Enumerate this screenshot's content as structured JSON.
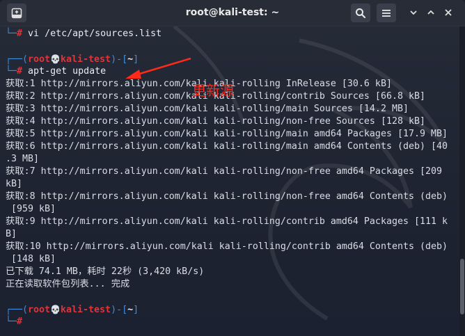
{
  "window": {
    "title": "root@kali-test: ~",
    "new_tab_icon": "terminal-plus-icon",
    "search_icon": "search-icon",
    "menu_icon": "hamburger-menu-icon",
    "minimize_icon": "minimize-icon",
    "maximize_icon": "maximize-icon",
    "close_icon": "close-icon"
  },
  "terminal": {
    "prev_command": "vi /etc/apt/sources.list",
    "prompt": {
      "open": "┌──(",
      "user": "root",
      "skull": "💀",
      "host": "kali-test",
      "mid": ")-[",
      "dir": "~",
      "close": "]",
      "corner": "└─",
      "symbol": "#"
    },
    "command": "apt-get update",
    "output": [
      "获取:1 http://mirrors.aliyun.com/kali kali-rolling InRelease [30.6 kB]",
      "获取:2 http://mirrors.aliyun.com/kali kali-rolling/contrib Sources [66.8 kB]",
      "获取:3 http://mirrors.aliyun.com/kali kali-rolling/main Sources [14.2 MB]",
      "获取:4 http://mirrors.aliyun.com/kali kali-rolling/non-free Sources [128 kB]",
      "获取:5 http://mirrors.aliyun.com/kali kali-rolling/main amd64 Packages [17.9 MB]",
      "获取:6 http://mirrors.aliyun.com/kali kali-rolling/main amd64 Contents (deb) [40",
      ".3 MB]",
      "获取:7 http://mirrors.aliyun.com/kali kali-rolling/non-free amd64 Packages [209",
      "kB]",
      "获取:8 http://mirrors.aliyun.com/kali kali-rolling/non-free amd64 Contents (deb)",
      " [959 kB]",
      "获取:9 http://mirrors.aliyun.com/kali kali-rolling/contrib amd64 Packages [111 k",
      "B]",
      "获取:10 http://mirrors.aliyun.com/kali kali-rolling/contrib amd64 Contents (deb)",
      " [148 kB]",
      "已下载 74.1 MB，耗时 22秒 (3,420 kB/s)",
      "正在读取软件包列表... 完成"
    ]
  },
  "annotation": {
    "text": "更新源",
    "color": "#ff2a1a"
  }
}
